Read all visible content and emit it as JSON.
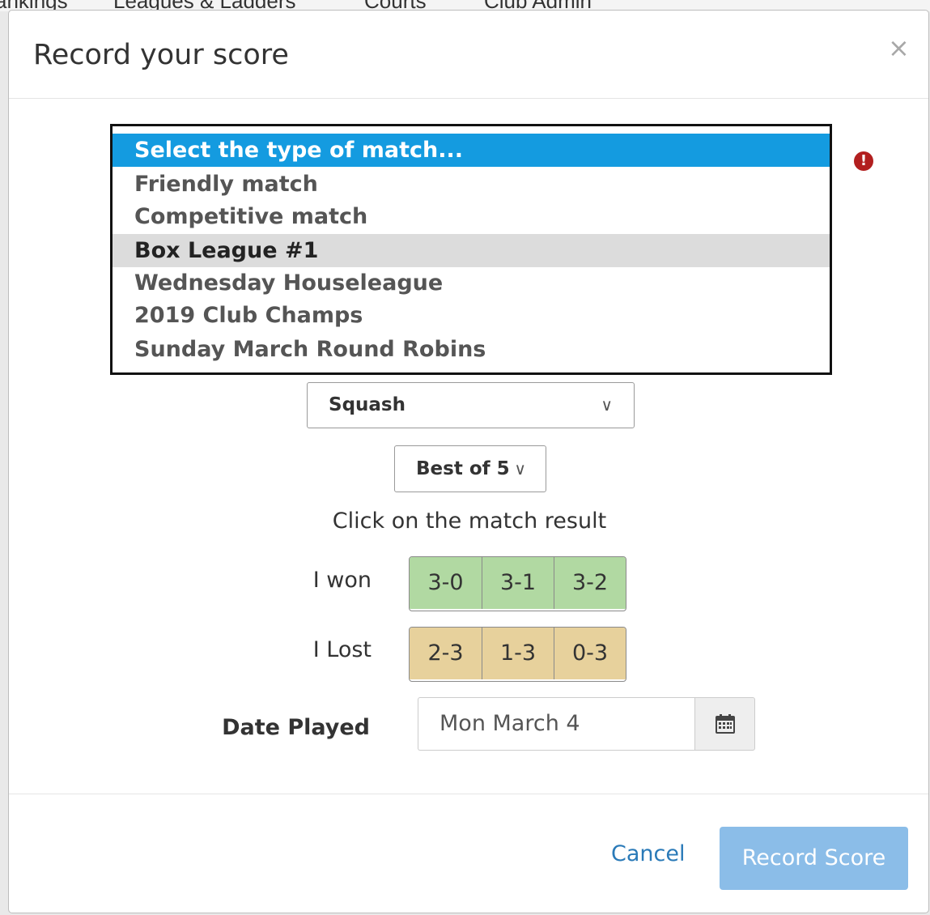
{
  "background_nav": {
    "items": [
      "ankings",
      "Leagues & Ladders",
      "Courts",
      "Club Admin"
    ]
  },
  "modal": {
    "title": "Record your score",
    "close_glyph": "×"
  },
  "match_type": {
    "options": [
      "Select the type of match...",
      "Friendly match",
      "Competitive match",
      "Box League #1",
      "Wednesday Houseleague",
      "2019 Club Champs",
      "Sunday March Round Robins"
    ],
    "selected_index": 0,
    "hovered_index": 3,
    "error_icon": "exclamation-circle-icon",
    "error_glyph": "!"
  },
  "sport": {
    "value": "Squash",
    "chevron": "∨"
  },
  "format": {
    "value": "Best of 5",
    "chevron": "∨"
  },
  "result": {
    "hint": "Click on the match result",
    "won_label": "I won",
    "won_options": [
      "3-0",
      "3-1",
      "3-2"
    ],
    "lost_label": "I Lost",
    "lost_options": [
      "2-3",
      "1-3",
      "0-3"
    ]
  },
  "date": {
    "label": "Date Played",
    "value": "Mon March 4",
    "icon": "calendar-icon"
  },
  "footer": {
    "cancel_label": "Cancel",
    "record_label": "Record Score"
  },
  "colors": {
    "selected_option": "#149be0",
    "hovered_option": "#dcdcdc",
    "won_button": "#b1d9a2",
    "lost_button": "#e7d19c",
    "primary_disabled": "#8bbde8",
    "link": "#2a7ab8",
    "error": "#b21f1f"
  }
}
